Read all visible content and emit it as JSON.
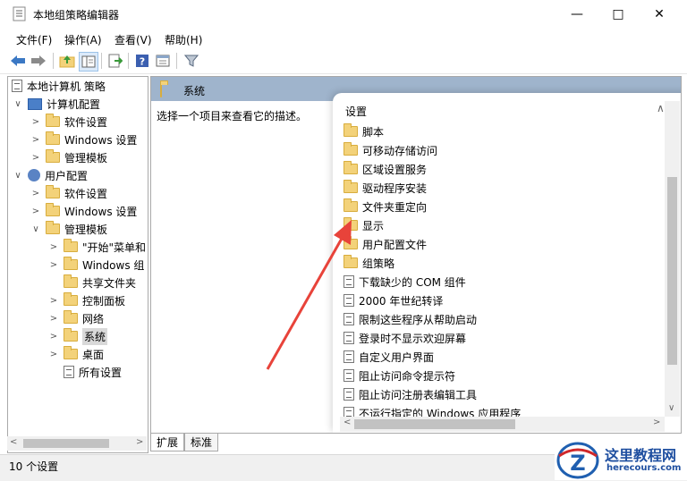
{
  "window": {
    "title": "本地组策略编辑器",
    "controls": [
      "minimize-icon",
      "maximize-icon",
      "close-icon"
    ]
  },
  "menu": [
    "文件(F)",
    "操作(A)",
    "查看(V)",
    "帮助(H)"
  ],
  "toolbar_icons": [
    "back-arrow-icon",
    "forward-arrow-icon",
    "up-folder-icon",
    "show-tree-icon",
    "export-icon",
    "help-icon",
    "properties-icon",
    "filter-icon"
  ],
  "tree": {
    "root": "本地计算机 策略",
    "nodes": [
      {
        "label": "计算机配置",
        "icon": "computer-icon"
      },
      {
        "label": "软件设置",
        "icon": "folder-icon"
      },
      {
        "label": "Windows 设置",
        "icon": "folder-icon"
      },
      {
        "label": "管理模板",
        "icon": "folder-icon"
      },
      {
        "label": "用户配置",
        "icon": "user-icon"
      },
      {
        "label": "软件设置",
        "icon": "folder-icon"
      },
      {
        "label": "Windows 设置",
        "icon": "folder-icon"
      },
      {
        "label": "管理模板",
        "icon": "folder-icon"
      },
      {
        "label": "\"开始\"菜单和",
        "icon": "folder-icon"
      },
      {
        "label": "Windows 组",
        "icon": "folder-icon"
      },
      {
        "label": "共享文件夹",
        "icon": "folder-icon"
      },
      {
        "label": "控制面板",
        "icon": "folder-icon"
      },
      {
        "label": "网络",
        "icon": "folder-icon"
      },
      {
        "label": "系统",
        "icon": "folder-icon"
      },
      {
        "label": "桌面",
        "icon": "folder-icon"
      },
      {
        "label": "所有设置",
        "icon": "settings-doc-icon"
      }
    ]
  },
  "content": {
    "header": "系统",
    "description": "选择一个项目来查看它的描述。",
    "column_header": "设置",
    "settings": [
      {
        "label": "脚本",
        "icon": "folder-icon"
      },
      {
        "label": "可移动存储访问",
        "icon": "folder-icon"
      },
      {
        "label": "区域设置服务",
        "icon": "folder-icon"
      },
      {
        "label": "驱动程序安装",
        "icon": "folder-icon"
      },
      {
        "label": "文件夹重定向",
        "icon": "folder-icon"
      },
      {
        "label": "显示",
        "icon": "folder-icon"
      },
      {
        "label": "用户配置文件",
        "icon": "folder-icon"
      },
      {
        "label": "组策略",
        "icon": "folder-icon"
      },
      {
        "label": "下载缺少的 COM 组件",
        "icon": "policy-icon"
      },
      {
        "label": "2000 年世纪转译",
        "icon": "policy-icon"
      },
      {
        "label": "限制这些程序从帮助启动",
        "icon": "policy-icon"
      },
      {
        "label": "登录时不显示欢迎屏幕",
        "icon": "policy-icon"
      },
      {
        "label": "自定义用户界面",
        "icon": "policy-icon"
      },
      {
        "label": "阻止访问命令提示符",
        "icon": "policy-icon"
      },
      {
        "label": "阻止访问注册表编辑工具",
        "icon": "policy-icon"
      },
      {
        "label": "不运行指定的 Windows 应用程序",
        "icon": "policy-icon"
      }
    ]
  },
  "tabs": [
    "扩展",
    "标准"
  ],
  "status": "10 个设置",
  "watermark": {
    "text": "这里教程网",
    "url": "herecours.com"
  },
  "colors": {
    "header_bg": "#9fb4cc",
    "arrow": "#e8433a"
  }
}
